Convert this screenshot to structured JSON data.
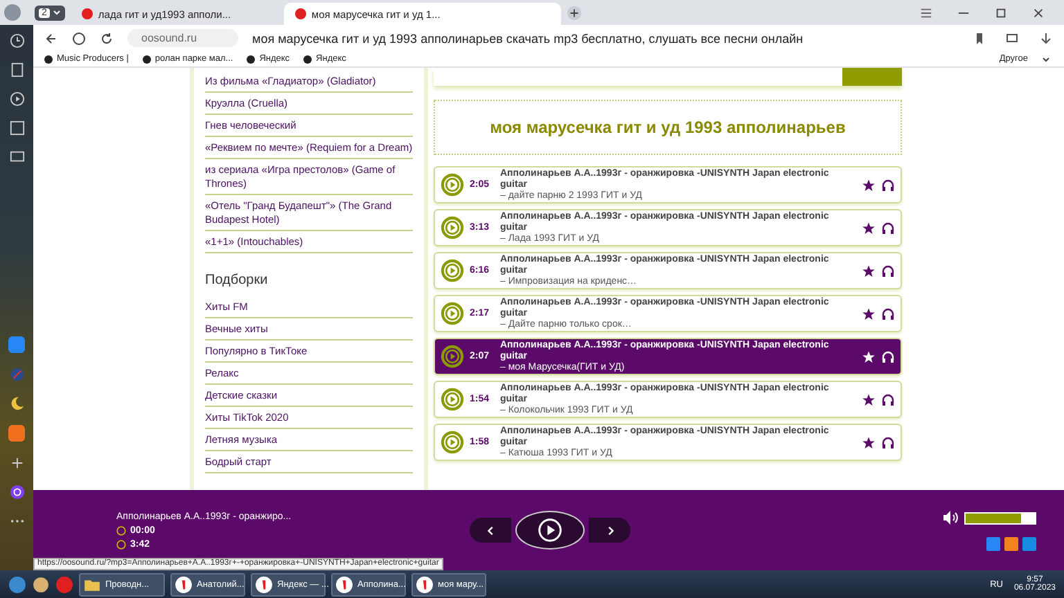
{
  "browser": {
    "tab_count": "2",
    "tabs": [
      {
        "title": "лада гит и уд1993 апполи...",
        "selected": false
      },
      {
        "title": "моя марусечка гит и уд 1...",
        "selected": true
      }
    ],
    "address": {
      "domain": "oosound.ru",
      "page_title": "моя марусечка гит и уд 1993 апполинарьев скачать mp3 бесплатно, слушать все песни онлайн"
    },
    "bookmarks": [
      "Music Producers |",
      "ролан парке мал...",
      "Яндекс",
      "Яндекс"
    ],
    "bookmarks_other": "Другое"
  },
  "sidebar": {
    "films": [
      "Из фильма «Гладиатор» (Gladiator)",
      "Круэлла (Cruella)",
      "Гнев человеческий",
      "«Реквием по мечте» (Requiem for a Dream)",
      "из сериала «Игра престолов» (Game of Thrones)",
      "«Отель \"Гранд Будапешт\"» (The Grand Budapest Hotel)",
      "«1+1» (Intouchables)"
    ],
    "heading": "Подборки",
    "collections": [
      "Хиты FM",
      "Вечные хиты",
      "Популярно в ТикТоке",
      "Релакс",
      "Детские сказки",
      "Хиты TikTok 2020",
      "Летняя музыка",
      "Бодрый старт"
    ]
  },
  "page_heading": "моя марусечка гит и уд 1993 апполинарьев",
  "tracks": [
    {
      "duration": "2:05",
      "title": "Апполинарьев А.А..1993г - оранжировка -UNISYNTH Japan electronic guitar",
      "subtitle": "– дайте парню 2 1993 ГИТ и УД",
      "selected": false
    },
    {
      "duration": "3:13",
      "title": "Апполинарьев А.А..1993г - оранжировка -UNISYNTH Japan electronic guitar",
      "subtitle": "– Лада 1993 ГИТ и УД",
      "selected": false
    },
    {
      "duration": "6:16",
      "title": "Апполинарьев А.А..1993г - оранжировка -UNISYNTH Japan electronic guitar",
      "subtitle": "– Импровизация на криденс…",
      "selected": false
    },
    {
      "duration": "2:17",
      "title": "Апполинарьев А.А..1993г - оранжировка -UNISYNTH Japan electronic guitar",
      "subtitle": "– Дайте парню только срок…",
      "selected": false
    },
    {
      "duration": "2:07",
      "title": "Апполинарьев А.А..1993г - оранжировка -UNISYNTH Japan electronic guitar",
      "subtitle": "– моя Марусечка(ГИТ и УД)",
      "selected": true
    },
    {
      "duration": "1:54",
      "title": "Апполинарьев А.А..1993г - оранжировка -UNISYNTH Japan electronic guitar",
      "subtitle": "– Колокольчик 1993 ГИТ и УД",
      "selected": false
    },
    {
      "duration": "1:58",
      "title": "Апполинарьев А.А..1993г - оранжировка -UNISYNTH Japan electronic guitar",
      "subtitle": "– Катюша 1993 ГИТ и УД",
      "selected": false
    }
  ],
  "player": {
    "title": "Апполинарьев А.А..1993г - оранжиро...",
    "elapsed": "00:00",
    "total": "3:42",
    "volume": {
      "level": 0.8
    }
  },
  "status_url": "https://oosound.ru/?mp3=Апполинарьев+А.А..1993г+-+оранжировка+-UNISYNTH+Japan+electronic+guitar",
  "taskbar": {
    "windows": [
      {
        "kind": "folder",
        "label": "Проводн..."
      },
      {
        "kind": "yandex",
        "label": "Анатолий..."
      },
      {
        "kind": "yandex",
        "label": "Яндекс — ..."
      },
      {
        "kind": "yandex",
        "label": "Апполина..."
      },
      {
        "kind": "yandex",
        "label": "моя мару..."
      }
    ],
    "language": "RU",
    "time": "9:57",
    "date": "06.07.2023"
  }
}
